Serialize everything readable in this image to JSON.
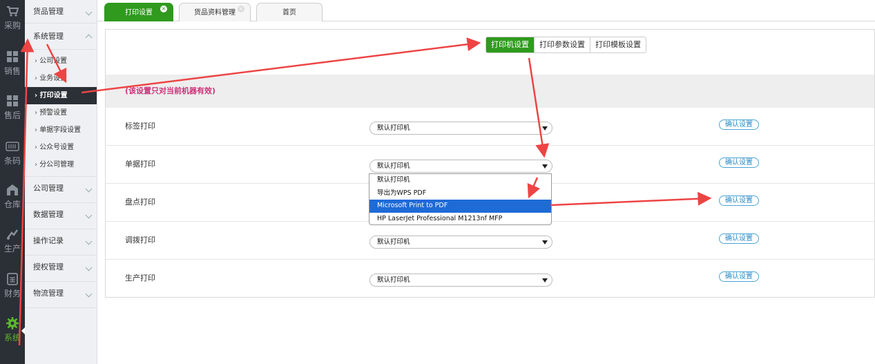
{
  "rail": [
    {
      "label": "采购",
      "icon": "cart-icon"
    },
    {
      "label": "销售",
      "icon": "grid-icon"
    },
    {
      "label": "售后",
      "icon": "grid-icon"
    },
    {
      "label": "条码",
      "icon": "barcode-icon"
    },
    {
      "label": "仓库",
      "icon": "warehouse-icon"
    },
    {
      "label": "生产",
      "icon": "production-icon"
    },
    {
      "label": "财务",
      "icon": "calculator-icon"
    },
    {
      "label": "系统",
      "icon": "gear-icon"
    }
  ],
  "menu": {
    "goods": "货品管理",
    "system": "系统管理",
    "subs": [
      "公司设置",
      "业务设置",
      "打印设置",
      "预警设置",
      "单据字段设置",
      "公众号设置",
      "分公司管理"
    ],
    "groups": [
      "公司管理",
      "数据管理",
      "操作记录",
      "授权管理",
      "物流管理"
    ]
  },
  "tabs": [
    {
      "label": "打印设置",
      "close": "×"
    },
    {
      "label": "货品资料管理",
      "close": "×"
    },
    {
      "label": "首页",
      "close": ""
    }
  ],
  "segments": [
    "打印机设置",
    "打印参数设置",
    "打印模板设置"
  ],
  "notice": "(该设置只对当前机器有效)",
  "rows": [
    {
      "label": "标签打印",
      "value": "默认打印机",
      "button": "确认设置"
    },
    {
      "label": "单据打印",
      "value": "默认打印机",
      "button": "确认设置"
    },
    {
      "label": "盘点打印",
      "value": "默认打印机",
      "button": "确认设置"
    },
    {
      "label": "调拨打印",
      "value": "默认打印机",
      "button": "确认设置"
    },
    {
      "label": "生产打印",
      "value": "默认打印机",
      "button": "确认设置"
    }
  ],
  "dropdown_options": [
    "默认打印机",
    "导出为WPS PDF",
    "Microsoft Print to PDF",
    "HP LaserJet Professional M1213nf MFP"
  ],
  "colors": {
    "accent": "#2f9a1e",
    "rail": "#2b2f36",
    "notice": "#d0337a",
    "annotation": "#ee4444",
    "selection": "#1e6bd6"
  }
}
